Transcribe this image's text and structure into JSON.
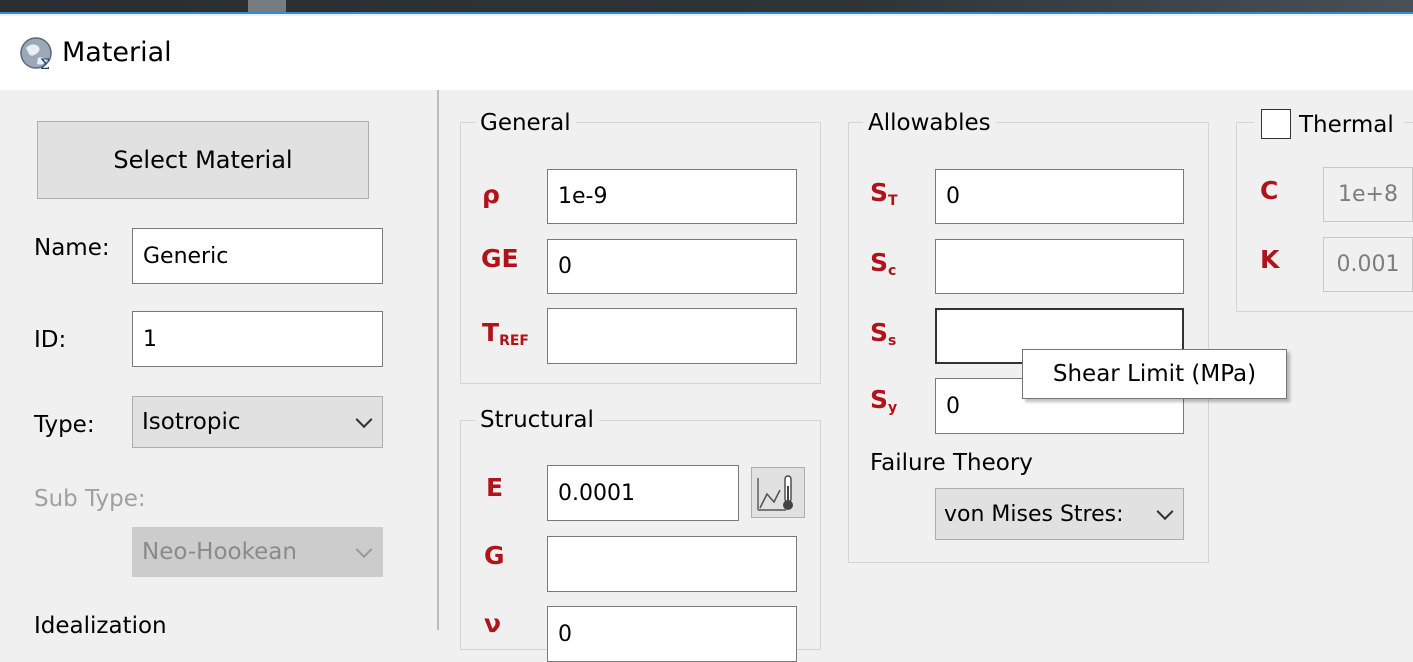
{
  "window": {
    "title": "Material"
  },
  "left": {
    "select_material": "Select Material",
    "name_label": "Name:",
    "name_value": "Generic",
    "id_label": "ID:",
    "id_value": "1",
    "type_label": "Type:",
    "type_value": "Isotropic",
    "subtype_label": "Sub Type:",
    "subtype_value": "Neo-Hookean",
    "cut_label": "Idealization"
  },
  "general": {
    "legend": "General",
    "rho_symbol": "ρ",
    "rho_value": "1e-9",
    "ge_symbol": "GE",
    "ge_value": "0",
    "tref_symbol": "T",
    "tref_sub": "REF",
    "tref_value": ""
  },
  "structural": {
    "legend": "Structural",
    "e_symbol": "E",
    "e_value": "0.0001",
    "g_symbol": "G",
    "g_value": "",
    "nu_symbol": "ν",
    "nu_value": "0"
  },
  "allowables": {
    "legend": "Allowables",
    "st_symbol": "S",
    "st_sub": "T",
    "st_value": "0",
    "sc_symbol": "S",
    "sc_sub": "c",
    "sc_value": "",
    "ss_symbol": "S",
    "ss_sub": "s",
    "ss_value": "",
    "sy_symbol": "S",
    "sy_sub": "y",
    "sy_value": "0",
    "failure_label": "Failure Theory",
    "failure_value": "von Mises Stres:"
  },
  "tooltip": {
    "text": "Shear Limit (MPa)"
  },
  "thermal": {
    "label": "Thermal",
    "checked": false,
    "c_symbol": "C",
    "c_value": "1e+8",
    "k_symbol": "K",
    "k_value": "0.001"
  },
  "colors": {
    "symbol": "#b0141b",
    "accent": "#2b8fd6"
  }
}
